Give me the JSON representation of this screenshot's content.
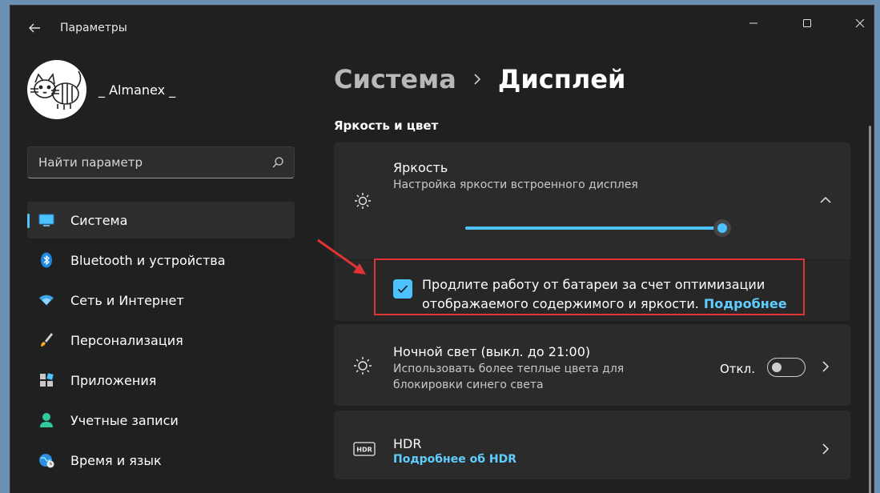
{
  "window": {
    "title": "Параметры",
    "user_name": "_ Almanex _"
  },
  "search": {
    "placeholder": "Найти параметр"
  },
  "sidebar": {
    "items": [
      {
        "label": "Система",
        "icon": "monitor-icon",
        "active": true
      },
      {
        "label": "Bluetooth и устройства",
        "icon": "bluetooth-icon"
      },
      {
        "label": "Сеть и Интернет",
        "icon": "wifi-icon"
      },
      {
        "label": "Персонализация",
        "icon": "brush-icon"
      },
      {
        "label": "Приложения",
        "icon": "apps-icon"
      },
      {
        "label": "Учетные записи",
        "icon": "person-icon"
      },
      {
        "label": "Время и язык",
        "icon": "globe-clock-icon"
      }
    ]
  },
  "main": {
    "breadcrumb_parent": "Система",
    "breadcrumb_current": "Дисплей",
    "section_title": "Яркость и цвет",
    "brightness": {
      "title": "Яркость",
      "subtitle": "Настройка яркости встроенного дисплея",
      "value_percent": 100
    },
    "battery_option": {
      "checked": true,
      "text": "Продлите работу от батареи за счет оптимизации отображаемого содержимого и яркости.",
      "link": "Подробнее"
    },
    "night_light": {
      "title": "Ночной свет (выкл. до 21:00)",
      "subtitle_line1": "Использовать более теплые цвета для",
      "subtitle_line2": "блокировки синего света",
      "toggle_label": "Откл.",
      "toggle_on": false
    },
    "hdr": {
      "title": "HDR",
      "link": "Подробнее об HDR"
    }
  },
  "colors": {
    "accent": "#4cc2ff",
    "link": "#60cdff",
    "annotation_red": "#e03434",
    "background": "#202020",
    "card": "#2b2b2b"
  }
}
